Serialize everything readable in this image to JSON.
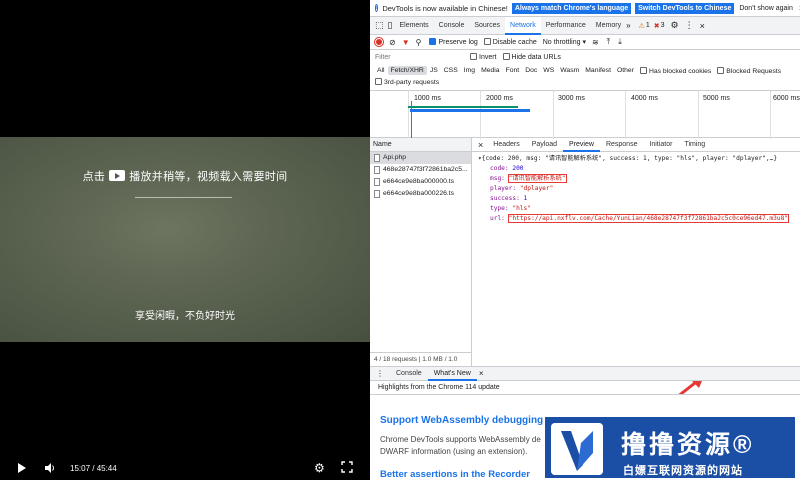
{
  "player": {
    "line1_prefix": "点击",
    "line1_suffix": "播放并稍等，视频载入需要时间",
    "line2": "享受闲暇，不负好时光",
    "time": "15:07 / 45:44"
  },
  "devtools": {
    "infobar": {
      "message": "DevTools is now available in Chinese!",
      "btn_match": "Always match Chrome's language",
      "btn_switch": "Switch DevTools to Chinese",
      "btn_dont": "Don't show again"
    },
    "tabs": [
      "Elements",
      "Console",
      "Sources",
      "Network",
      "Performance",
      "Memory"
    ],
    "active_tab": "Network",
    "warn_count": "1",
    "err_count": "3",
    "toolbar": {
      "preserve_log": "Preserve log",
      "disable_cache": "Disable cache",
      "throttling": "No throttling"
    },
    "filter": {
      "placeholder": "Filter",
      "invert": "Invert",
      "hide_data_urls": "Hide data URLs"
    },
    "types": [
      "All",
      "Fetch/XHR",
      "JS",
      "CSS",
      "Img",
      "Media",
      "Font",
      "Doc",
      "WS",
      "Wasm",
      "Manifest",
      "Other"
    ],
    "selected_type": "Fetch/XHR",
    "has_blocked_cookies": "Has blocked cookies",
    "blocked_requests": "Blocked Requests",
    "third_party": "3rd-party requests",
    "timeline_ticks": [
      "1000 ms",
      "2000 ms",
      "3000 ms",
      "4000 ms",
      "5000 ms",
      "6000 ms"
    ],
    "requests": {
      "header": "Name",
      "items": [
        "Api.php",
        "468e28747f3f72861ba2c5...",
        "e664ce9e8ba000000.ts",
        "e664ce9e8ba000226.ts"
      ],
      "status": "4 / 18 requests  |  1.0 MB / 1.0"
    },
    "detail_tabs": [
      "Headers",
      "Payload",
      "Preview",
      "Response",
      "Initiator",
      "Timing"
    ],
    "active_detail_tab": "Preview",
    "preview": {
      "summary": "{code: 200, msg: \"请讯智能解析系统\", success: 1, type: \"hls\", player: \"dplayer\",…}",
      "code_key": "code: ",
      "code_val": "200",
      "msg_key": "msg: ",
      "msg_val": "\"请讯智能解析系统\"",
      "player_key": "player: ",
      "player_val": "\"dplayer\"",
      "success_key": "success: ",
      "success_val": "1",
      "type_key": "type: ",
      "type_val": "\"hls\"",
      "url_key": "url: ",
      "url_val": "\"https://api.nxflv.com/Cache/YunLian/468e28747f3f72861ba2c5c0ce96ed47.m3u8\""
    },
    "drawer": {
      "tabs": [
        "Console",
        "What's New"
      ],
      "active": "What's New",
      "subtitle": "Highlights from the Chrome 114 update",
      "title1": "Support WebAssembly debugging",
      "text1": "Chrome DevTools supports WebAssembly de",
      "text1b": "DWARF information (using an extension).",
      "title2": "Better assertions in the Recorder"
    }
  },
  "watermark": {
    "title": "撸撸资源®",
    "subtitle": "白嫖互联网资源的网站"
  },
  "colors": {
    "accent": "#1a73e8",
    "highlight": "#e53935",
    "watermark_bg": "#1b4fa6"
  }
}
